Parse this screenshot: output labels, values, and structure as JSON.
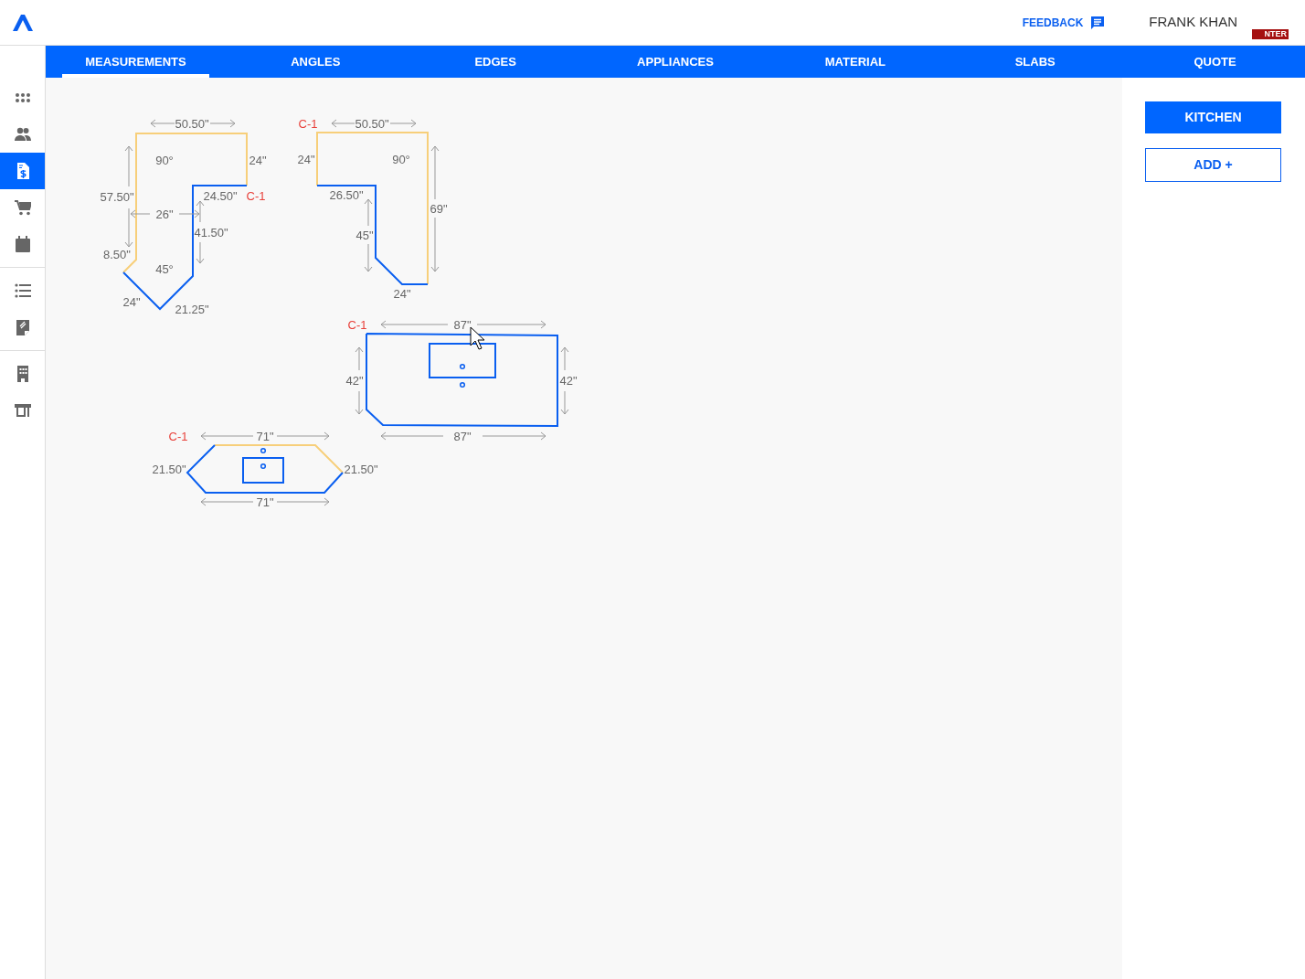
{
  "header": {
    "feedback": "FEEDBACK",
    "user": "FRANK KHAN",
    "badge": "NTER"
  },
  "sidebar": {
    "groups": [
      {
        "items": [
          {
            "selected": false
          },
          {
            "selected": false
          },
          {
            "selected": true
          },
          {
            "selected": false
          },
          {
            "selected": false
          }
        ]
      },
      {
        "items": [
          {
            "selected": false
          },
          {
            "selected": false
          }
        ]
      },
      {
        "items": [
          {
            "selected": false
          },
          {
            "selected": false
          }
        ]
      }
    ]
  },
  "tabs": [
    {
      "label": "MEASUREMENTS",
      "selected": true
    },
    {
      "label": "ANGLES",
      "selected": false
    },
    {
      "label": "EDGES",
      "selected": false
    },
    {
      "label": "APPLIANCES",
      "selected": false
    },
    {
      "label": "MATERIAL",
      "selected": false
    },
    {
      "label": "SLABS",
      "selected": false
    },
    {
      "label": "QUOTE",
      "selected": false
    }
  ],
  "canvas": {
    "pieces": [
      {
        "tag": "C-1",
        "edges": [
          {
            "color": "#f7cf7a"
          },
          {
            "color": "#0a5ff0"
          }
        ],
        "labels": [
          "50.50\"",
          "90°",
          "24\"",
          "57.50\"",
          "24.50\"",
          "26\"",
          "41.50\"",
          "8.50\"",
          "45°",
          "24\"",
          "21.25\""
        ]
      },
      {
        "tag": "C-1",
        "edges": [
          {
            "color": "#f7cf7a"
          },
          {
            "color": "#0a5ff0"
          }
        ],
        "labels": [
          "50.50\"",
          "24\"",
          "90°",
          "26.50\"",
          "69\"",
          "45\"",
          "24\""
        ]
      },
      {
        "tag": "C-1",
        "edges": [
          {
            "color": "#0a5ff0"
          }
        ],
        "cutouts": [
          {
            "kind": "sink"
          },
          {
            "kind": "hole"
          },
          {
            "kind": "hole"
          }
        ],
        "labels": [
          "87\"",
          "42\"",
          "42\"",
          "87\""
        ]
      },
      {
        "tag": "C-1",
        "edges": [
          {
            "color": "#f7cf7a"
          },
          {
            "color": "#0a5ff0"
          }
        ],
        "cutouts": [
          {
            "kind": "sink"
          },
          {
            "kind": "hole"
          },
          {
            "kind": "hole"
          }
        ],
        "labels": [
          "71\"",
          "21.50\"",
          "21.50\"",
          "71\""
        ]
      }
    ]
  },
  "rooms": [
    {
      "label": "KITCHEN",
      "selected": true
    },
    {
      "label": "ADD +",
      "selected": false
    }
  ]
}
